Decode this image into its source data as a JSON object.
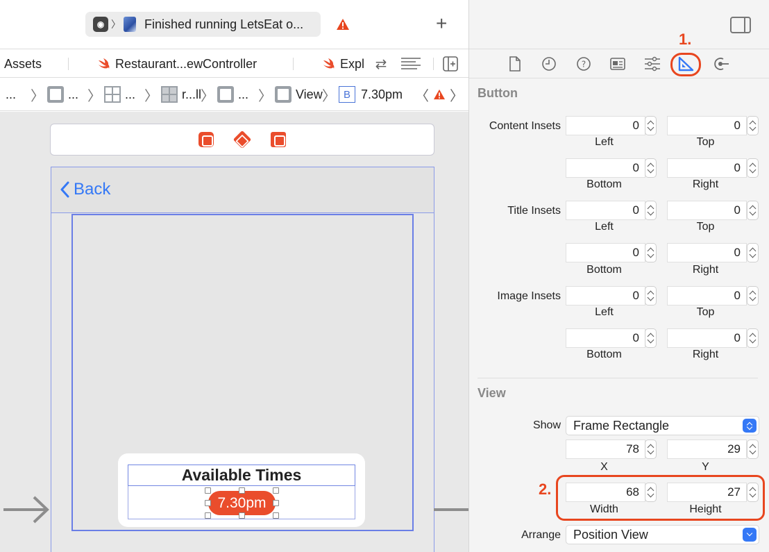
{
  "titlebar": {
    "status_text": "Finished running LetsEat o...",
    "add_tab": "+"
  },
  "tabs": [
    {
      "label": "Assets"
    },
    {
      "label": "Restaurant...ewController"
    },
    {
      "label": "Expl"
    }
  ],
  "jumpbar": {
    "c1": "...",
    "c2": "...",
    "c3": "...",
    "c4": "r...ll",
    "c5": "...",
    "c6": "View",
    "c7_badge": "B",
    "c7": "7.30pm"
  },
  "canvas": {
    "back_label": "Back",
    "times_header": "Available Times",
    "time_button": "7.30pm"
  },
  "inspector": {
    "button_section": "Button",
    "content_insets": {
      "label": "Content Insets",
      "left": "0",
      "top": "0",
      "bottom": "0",
      "right": "0"
    },
    "title_insets": {
      "label": "Title Insets",
      "left": "0",
      "top": "0",
      "bottom": "0",
      "right": "0"
    },
    "image_insets": {
      "label": "Image Insets",
      "left": "0",
      "top": "0",
      "bottom": "0",
      "right": "0"
    },
    "sub_labels": {
      "left": "Left",
      "top": "Top",
      "bottom": "Bottom",
      "right": "Right"
    },
    "view_section": "View",
    "show_label": "Show",
    "show_value": "Frame Rectangle",
    "x_value": "78",
    "y_value": "29",
    "x_label": "X",
    "y_label": "Y",
    "width_value": "68",
    "height_value": "27",
    "width_label": "Width",
    "height_label": "Height",
    "arrange_label": "Arrange",
    "arrange_value": "Position View"
  },
  "callouts": {
    "one": "1.",
    "two": "2."
  },
  "colors": {
    "accent": "#3478f6",
    "annotation": "#e8461f",
    "button": "#ea4d2c"
  }
}
